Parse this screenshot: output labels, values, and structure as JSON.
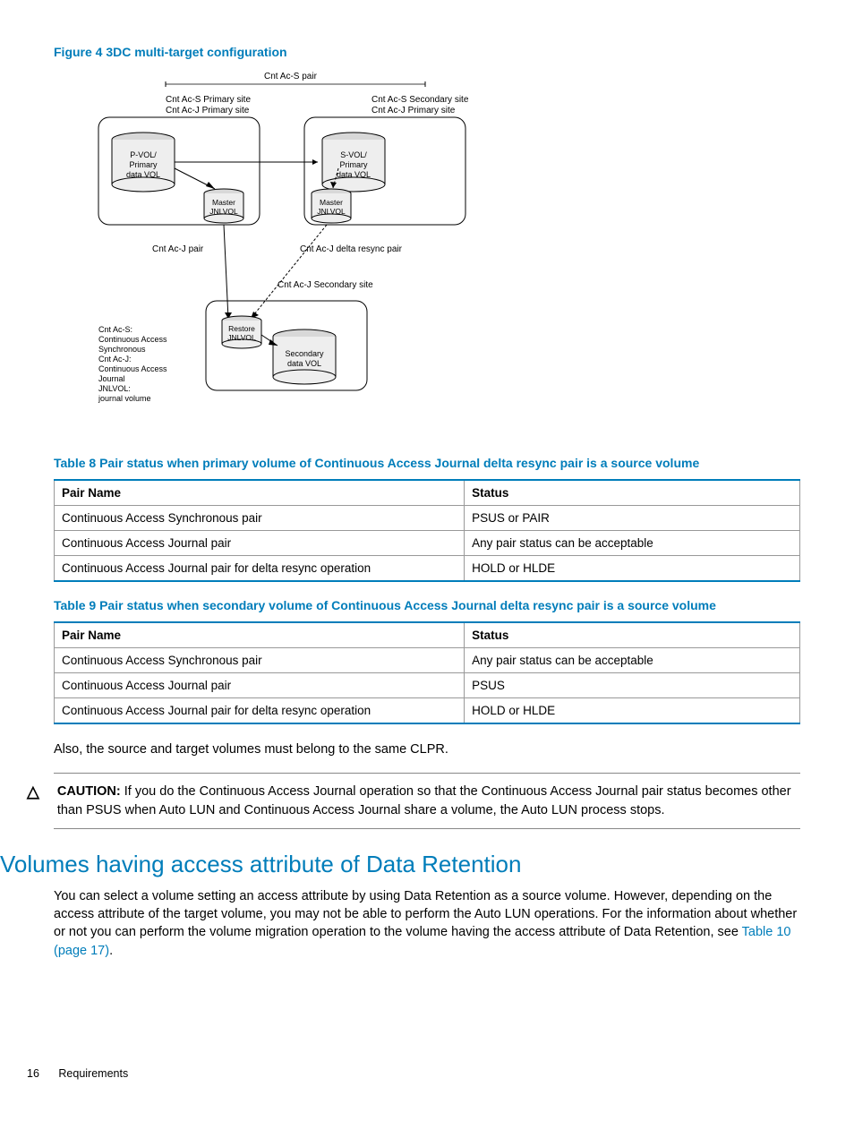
{
  "figure": {
    "title": "Figure 4 3DC multi-target configuration",
    "labels": {
      "top_pair": "Cnt Ac-S pair",
      "left_site1": "Cnt Ac-S Primary site",
      "left_site2": "Cnt Ac-J Primary site",
      "right_site1": "Cnt Ac-S Secondary site",
      "right_site2": "Cnt Ac-J  Primary site",
      "pvol1": "P-VOL/",
      "pvol2": "Primary",
      "pvol3": "data VOL",
      "svol1": "S-VOL/",
      "svol2": "Primary",
      "svol3": "data VOL",
      "master1": "Master",
      "master2": "JNLVOL",
      "cntacj_pair": "Cnt Ac-J  pair",
      "delta_resync": "Cnt Ac-J delta resync pair",
      "secondary_site": "Cnt Ac-J  Secondary site",
      "restore1": "Restore",
      "restore2": "JNLVOL",
      "sec1": "Secondary",
      "sec2": "data VOL",
      "legend1": "Cnt Ac-S:",
      "legend2": "Continuous Access",
      "legend3": "Synchronous",
      "legend4": "Cnt Ac-J:",
      "legend5": "Continuous Access",
      "legend6": "Journal",
      "legend7": "JNLVOL:",
      "legend8": "journal volume"
    }
  },
  "table8": {
    "title": "Table 8 Pair status when primary volume of Continuous Access Journal delta resync pair is a source volume",
    "headers": [
      "Pair Name",
      "Status"
    ],
    "rows": [
      [
        "Continuous Access Synchronous pair",
        "PSUS or PAIR"
      ],
      [
        "Continuous Access Journal pair",
        "Any pair status can be acceptable"
      ],
      [
        "Continuous Access Journal pair for delta resync operation",
        "HOLD or HLDE"
      ]
    ]
  },
  "table9": {
    "title": "Table 9 Pair status when secondary volume of Continuous Access Journal delta resync pair is a source volume",
    "headers": [
      "Pair Name",
      "Status"
    ],
    "rows": [
      [
        "Continuous Access Synchronous pair",
        "Any pair status can be acceptable"
      ],
      [
        "Continuous Access Journal pair",
        "PSUS"
      ],
      [
        "Continuous Access Journal pair for delta resync operation",
        "HOLD or HLDE"
      ]
    ]
  },
  "body1": "Also, the source and target volumes must belong to the same CLPR.",
  "caution": {
    "label": "CAUTION:",
    "text": " If you do the Continuous Access Journal operation so that the Continuous Access Journal pair status becomes other than PSUS when Auto LUN and Continuous Access Journal share a volume, the Auto LUN process stops."
  },
  "section_heading": "Volumes having access attribute of Data Retention",
  "body2_pre": "You can select a volume setting an access attribute by using Data Retention as a source volume. However, depending on the access attribute of the target volume, you may not be able to perform the Auto LUN operations. For the information about whether or not you can perform the volume migration operation to the volume having the access attribute of Data Retention, see ",
  "body2_link": "Table 10 (page 17)",
  "body2_post": ".",
  "footer": {
    "page": "16",
    "section": "Requirements"
  }
}
